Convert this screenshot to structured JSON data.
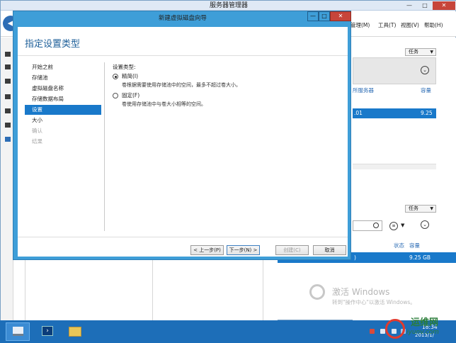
{
  "background": {
    "title": "服务器管理器",
    "window_controls": {
      "minimize": "—",
      "maximize": "□",
      "close": "✕"
    },
    "menus": [
      "管理(M)",
      "工具(T)",
      "视图(V)",
      "帮助(H)"
    ],
    "tasks_label": "任务",
    "columns_top": {
      "server": "所服务器",
      "capacity": "容量"
    },
    "row_top": {
      "server": ".01",
      "capacity": "9.25 G"
    },
    "columns_bottom": {
      "status": "状态",
      "capacity": "容量"
    },
    "row_bottom": {
      "server": ")",
      "capacity": "9.25 GB"
    },
    "activation": {
      "title": "激活 Windows",
      "desc": "转到\"操作中心\"以激活 Windows。"
    }
  },
  "taskbar": {
    "clock_time": "18:34",
    "clock_date": "2013/1/"
  },
  "watermark": {
    "name": "运维网",
    "url": "iyunv.com"
  },
  "wizard": {
    "title": "新建虚拟磁盘向导",
    "heading": "指定设置类型",
    "steps": [
      {
        "label": "开始之前",
        "state": "normal"
      },
      {
        "label": "存储池",
        "state": "normal"
      },
      {
        "label": "虚拟磁盘名称",
        "state": "normal"
      },
      {
        "label": "存储数据布局",
        "state": "normal"
      },
      {
        "label": "设置",
        "state": "active"
      },
      {
        "label": "大小",
        "state": "normal"
      },
      {
        "label": "确认",
        "state": "disabled"
      },
      {
        "label": "结果",
        "state": "disabled"
      }
    ],
    "section_label": "设置类型:",
    "options": {
      "thin": {
        "label": "精简(I)",
        "desc": "卷根据需要使用存储池中的空间，最多不超过卷大小。",
        "selected": true
      },
      "fixed": {
        "label": "固定(F)",
        "desc": "卷使用存储池中与卷大小相等的空间。",
        "selected": false
      }
    },
    "buttons": {
      "prev": "< 上一步(P)",
      "next": "下一步(N) >",
      "create": "创建(C)",
      "cancel": "取消"
    }
  }
}
